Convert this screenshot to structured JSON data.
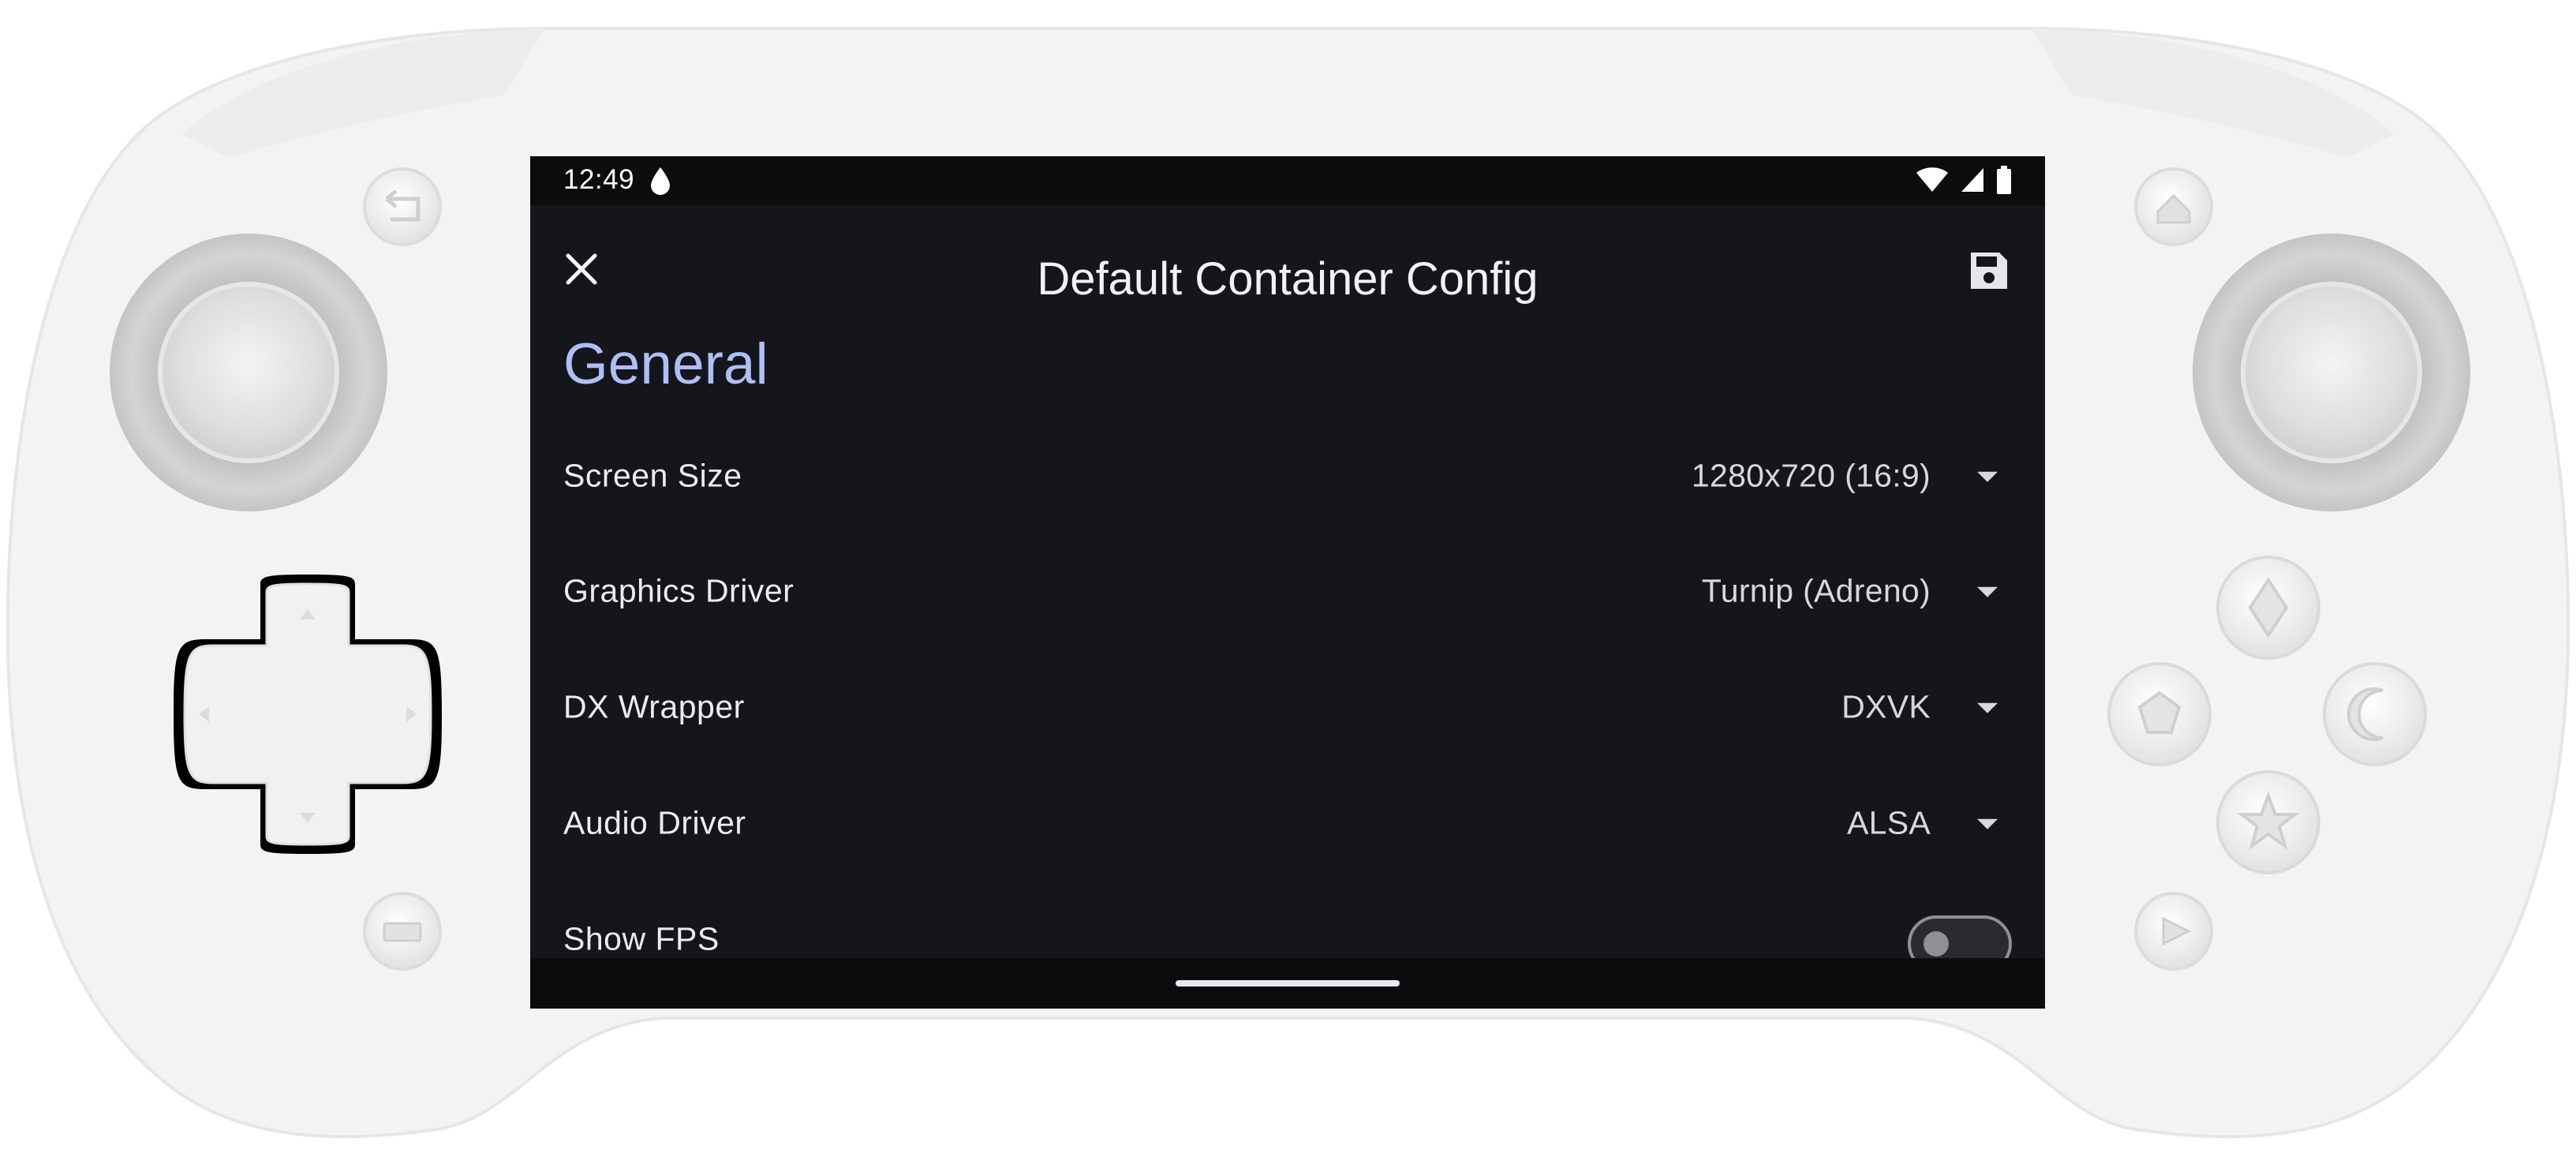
{
  "status_bar": {
    "time": "12:49",
    "icons": [
      "water-drop-icon",
      "wifi-icon",
      "cellular-icon",
      "battery-icon"
    ]
  },
  "app_bar": {
    "title": "Default Container Config",
    "close_icon": "close-icon",
    "save_icon": "save-icon"
  },
  "section": {
    "title": "General"
  },
  "settings": [
    {
      "label": "Screen Size",
      "value": "1280x720 (16:9)",
      "control": "dropdown"
    },
    {
      "label": "Graphics Driver",
      "value": "Turnip (Adreno)",
      "control": "dropdown"
    },
    {
      "label": "DX Wrapper",
      "value": "DXVK",
      "control": "dropdown"
    },
    {
      "label": "Audio Driver",
      "value": "ALSA",
      "control": "dropdown"
    },
    {
      "label": "Show FPS",
      "value": "off",
      "control": "toggle"
    }
  ],
  "colors": {
    "accent": "#aebff5",
    "screen_bg": "#15161b",
    "bar_bg": "#0b0c0e",
    "shell": "#f2f2f2"
  }
}
